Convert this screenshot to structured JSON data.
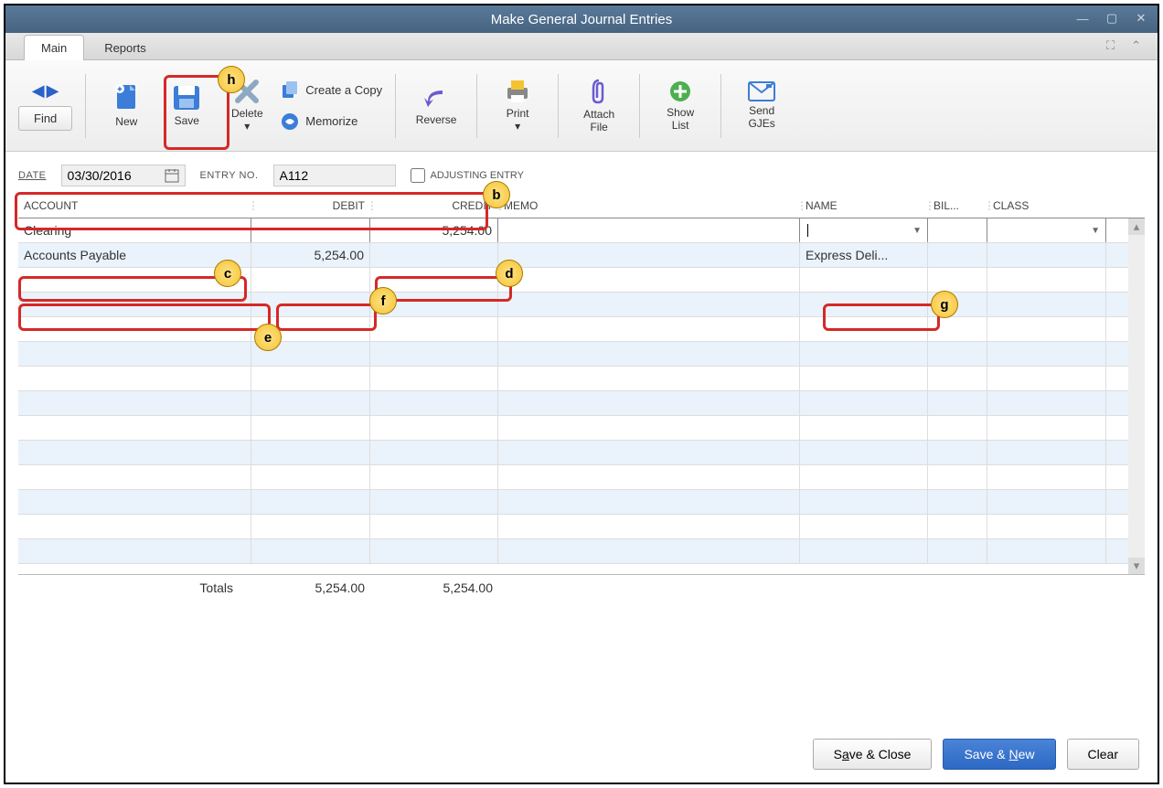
{
  "window": {
    "title": "Make General Journal Entries"
  },
  "tabs": {
    "main": "Main",
    "reports": "Reports"
  },
  "ribbon": {
    "find": "Find",
    "new": "New",
    "save": "Save",
    "delete": "Delete",
    "create_copy": "Create a Copy",
    "memorize": "Memorize",
    "reverse": "Reverse",
    "print": "Print",
    "attach_file_l1": "Attach",
    "attach_file_l2": "File",
    "show_list_l1": "Show",
    "show_list_l2": "List",
    "send_gjes_l1": "Send",
    "send_gjes_l2": "GJEs"
  },
  "header": {
    "date_label": "DATE",
    "date_value": "03/30/2016",
    "entry_label": "ENTRY NO.",
    "entry_value": "A112",
    "adj_label": "ADJUSTING ENTRY"
  },
  "grid": {
    "headers": {
      "account": "ACCOUNT",
      "debit": "DEBIT",
      "credit": "CREDIT",
      "memo": "MEMO",
      "name": "NAME",
      "bil": "BIL...",
      "class": "CLASS"
    },
    "rows": [
      {
        "account": "Clearing",
        "debit": "",
        "credit": "5,254.00",
        "memo": "",
        "name": "",
        "bil": "",
        "class": ""
      },
      {
        "account": "Accounts Payable",
        "debit": "5,254.00",
        "credit": "",
        "memo": "",
        "name": "Express Deli...",
        "bil": "",
        "class": ""
      }
    ],
    "totals_label": "Totals",
    "total_debit": "5,254.00",
    "total_credit": "5,254.00"
  },
  "footer": {
    "save_close": "Save & Close",
    "save_new": "Save & New",
    "clear": "Clear"
  },
  "callouts": {
    "b": "b",
    "c": "c",
    "d": "d",
    "e": "e",
    "f": "f",
    "g": "g",
    "h": "h"
  }
}
